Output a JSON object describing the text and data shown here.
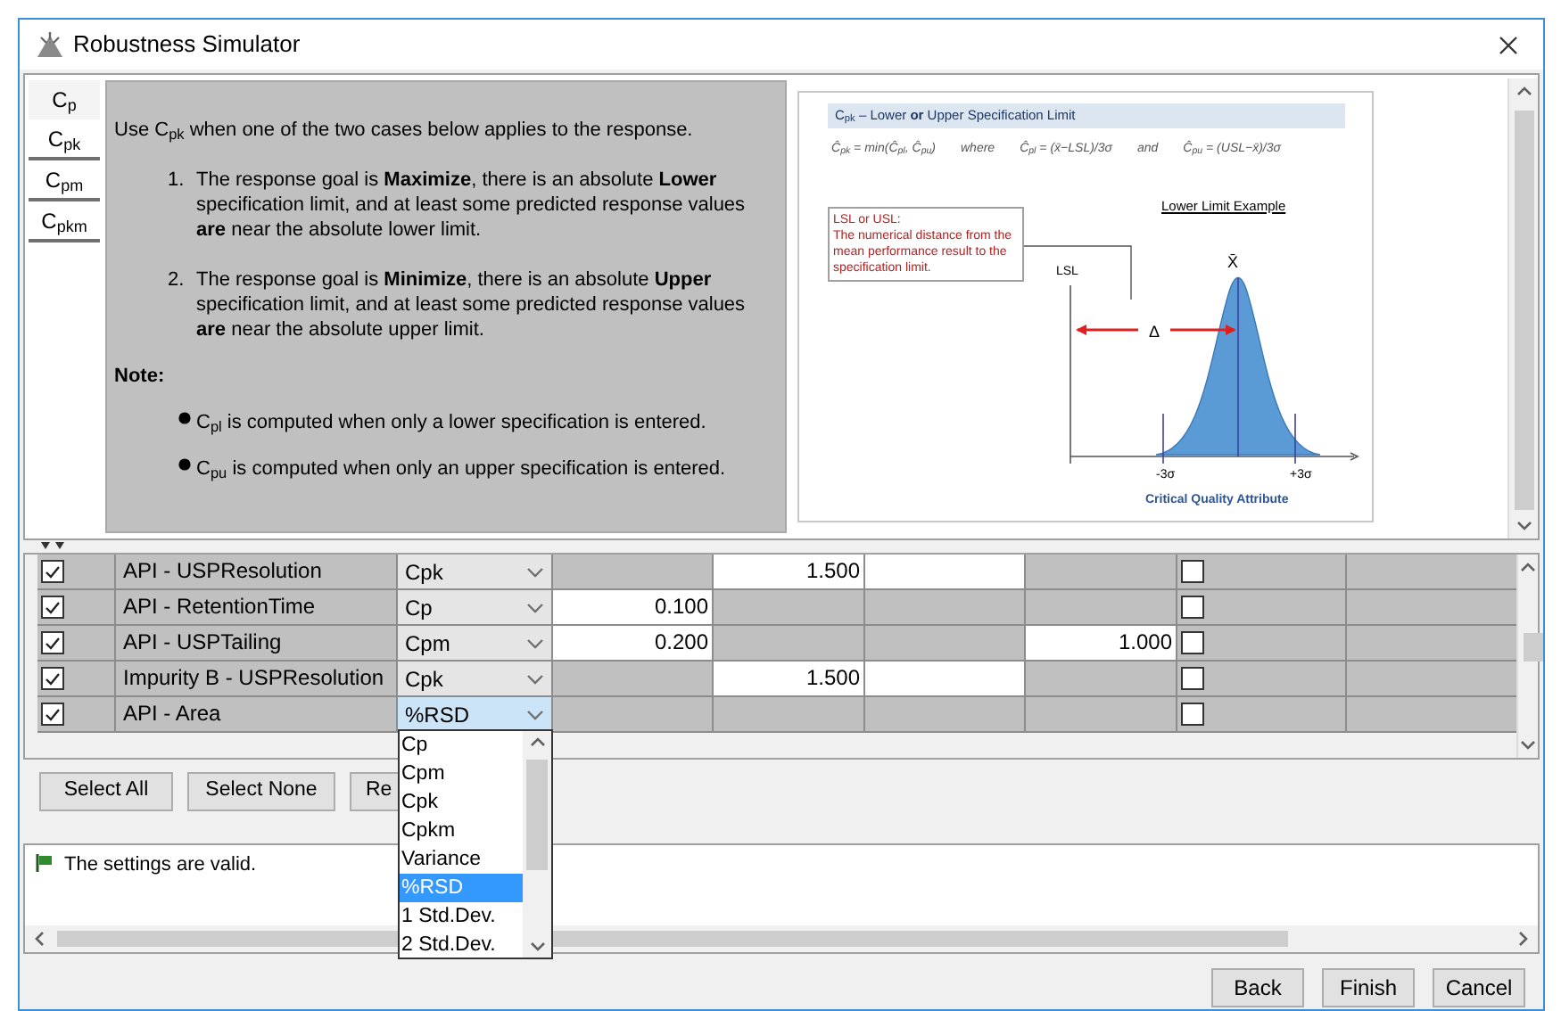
{
  "window": {
    "title": "Robustness Simulator"
  },
  "help_tabs": [
    {
      "label": "C$_{p}$",
      "selected": true
    },
    {
      "label": "C$_{pk}$",
      "selected": false
    },
    {
      "label": "C$_{pm}$",
      "selected": false
    },
    {
      "label": "C$_{pkm}$",
      "selected": false
    }
  ],
  "help": {
    "intro": "Use C$_{pk}$ when one of the two cases below applies to the response.",
    "cases": [
      {
        "number": "1.",
        "text": "The response goal is **Maximize**, there is an absolute **Lower** specification limit, and at least some predicted response values **are** near the absolute lower limit."
      },
      {
        "number": "2.",
        "text": "The response goal is **Minimize**, there is an absolute **Upper** specification limit, and at least some predicted response values **are** near the absolute upper limit."
      }
    ],
    "note_label": "Note:",
    "notes": [
      "C$_{pl}$ is computed when only a lower specification is entered.",
      "C$_{pu}$ is computed when only an upper specification is entered."
    ]
  },
  "diagram": {
    "header": "C$_{pk}$ – Lower **or** Upper Specification Limit",
    "formulas": [
      "Ĉ$_{pk}$ = min(Ĉ$_{pl}$, Ĉ$_{pu}$)",
      "where",
      "Ĉ$_{pl}$ = (x̄−LSL)/3σ",
      "and",
      "Ĉ$_{pu}$ = (USL−x̄)/3σ"
    ],
    "callout_title": "LSL or USL:",
    "callout_text": "The numerical distance from the mean performance result to the specification limit.",
    "example_title": "Lower Limit  Example",
    "lsl": "LSL",
    "mean": "X̄",
    "delta": "Δ",
    "minus": "-3σ",
    "plus": "+3σ",
    "axis_title": "Critical Quality Attribute"
  },
  "rows": [
    {
      "checked": true,
      "name": "API - USPResolution",
      "type": "Cpk",
      "open": false,
      "cells": [
        {
          "editable": false
        },
        {
          "editable": true,
          "value": "1.500"
        },
        {
          "editable": true
        },
        {
          "editable": false
        }
      ],
      "flag": false
    },
    {
      "checked": true,
      "name": "API - RetentionTime",
      "type": "Cp",
      "open": false,
      "cells": [
        {
          "editable": true,
          "value": "0.100"
        },
        {
          "editable": false
        },
        {
          "editable": false
        },
        {
          "editable": false
        }
      ],
      "flag": false
    },
    {
      "checked": true,
      "name": "API - USPTailing",
      "type": "Cpm",
      "open": false,
      "cells": [
        {
          "editable": true,
          "value": "0.200"
        },
        {
          "editable": false
        },
        {
          "editable": false
        },
        {
          "editable": true,
          "value": "1.000"
        }
      ],
      "flag": false
    },
    {
      "checked": true,
      "name": "Impurity B - USPResolution",
      "type": "Cpk",
      "open": false,
      "cells": [
        {
          "editable": false
        },
        {
          "editable": true,
          "value": "1.500"
        },
        {
          "editable": true
        },
        {
          "editable": false
        }
      ],
      "flag": false
    },
    {
      "checked": true,
      "name": "API - Area",
      "type": "%RSD",
      "open": true,
      "cells": [
        {
          "editable": false
        },
        {
          "editable": false
        },
        {
          "editable": false
        },
        {
          "editable": false
        }
      ],
      "flag": false
    }
  ],
  "buttons": [
    "Select All",
    "Select None",
    "Re"
  ],
  "dropdown_options": [
    {
      "label": "Cp",
      "selected": false
    },
    {
      "label": "Cpm",
      "selected": false
    },
    {
      "label": "Cpk",
      "selected": false
    },
    {
      "label": "Cpkm",
      "selected": false
    },
    {
      "label": "Variance",
      "selected": false
    },
    {
      "label": "%RSD",
      "selected": true
    },
    {
      "label": "1 Std.Dev.",
      "selected": false
    },
    {
      "label": "2 Std.Dev.",
      "selected": false
    }
  ],
  "message": "The settings are valid.",
  "footer_buttons": [
    "Back",
    "Finish",
    "Cancel"
  ]
}
